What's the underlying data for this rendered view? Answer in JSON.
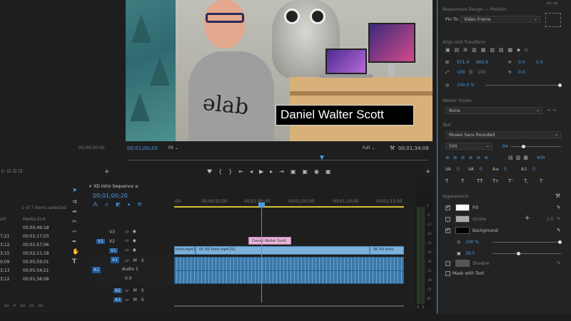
{
  "program_monitor": {
    "lower_third": "Daniel Walter Scott",
    "shirt_text": "ǝlab",
    "timecode_current": "00;01;00;20",
    "fit": "Fit",
    "quality": "Full",
    "timecode_duration": "00;01;34;09",
    "source_timecode": "00;00;00;00"
  },
  "project": {
    "items_selected": "1 of 7 items selected",
    "col_start": "art",
    "col_end": "Media End",
    "rows": [
      {
        "start": "",
        "end": "00;00;49;18"
      },
      {
        "start": "7;21",
        "end": "00;01;17;03"
      },
      {
        "start": "3;12",
        "end": "00;01;57;06"
      },
      {
        "start": "3;15",
        "end": "00;02;11;18"
      },
      {
        "start": "0;09",
        "end": "00;05;59;01"
      },
      {
        "start": "3;13",
        "end": "00;05;54;21"
      },
      {
        "start": "3;12",
        "end": "00;01;34;08"
      }
    ]
  },
  "timeline": {
    "sequence_name": "XD Intro Sequence",
    "timecode": "00;01;00;20",
    "ruler": [
      ";00",
      "00;00;55;00",
      "00;01;00;00",
      "00;01;05;00",
      "00;01;10;00",
      "00;01;15;00"
    ],
    "video_tracks": [
      "V3",
      "V2",
      "V1"
    ],
    "audio_tracks": [
      "A1",
      "A2",
      "A3"
    ],
    "audio_label": "Audio 1",
    "graphic_clip": "Daniel Walter Scott",
    "clip_left": "Intro.mp4 [V]",
    "clip_mid": "05 XD Intro.mp4 [V]",
    "clip_right": "06 XD Intro",
    "audio_volume": "0.0",
    "meter_scale": [
      "0",
      "-6",
      "-12",
      "-18",
      "-24",
      "-30",
      "-36",
      "-42",
      "-48",
      "-54",
      "dB"
    ],
    "meter_labels": [
      "S",
      "S"
    ]
  },
  "essential_graphics": {
    "responsive_heading": "Responsive Design — Position",
    "pin_to_label": "Pin To:",
    "pin_to_value": "Video Frame",
    "align_heading": "Align and Transform",
    "pos_x": "971.4",
    "pos_y": "960.6",
    "anchor_x": "0.0",
    "anchor_y": "0.0",
    "scale_w": "100",
    "scale_h": "100",
    "rotation": "0.0",
    "opacity": "100.0 %",
    "master_heading": "Master Styles",
    "master_value": "None",
    "text_heading": "Text",
    "font": "Museo Sans Rounded",
    "weight": "500",
    "size": "94",
    "tracking_vals": [
      "0",
      "0",
      "0",
      "0"
    ],
    "leading_val": "400",
    "style_buttons": [
      "T",
      "T",
      "TT",
      "Tт",
      "T'",
      "T,",
      "T"
    ],
    "appearance_heading": "Appearance",
    "fill_label": "Fill",
    "stroke_label": "Stroke",
    "stroke_width": "1.0",
    "background_label": "Background",
    "bg_opacity": "100 %",
    "bg_size": "39.5",
    "shadow_label": "Shadow",
    "mask_label": "Mask with Text",
    "colors": {
      "accent": "#4a9be8",
      "fill": "#ffffff",
      "background": "#000000",
      "graphic_clip": "#e8b4d8",
      "video_clip": "#7bb0d8",
      "audio_clip": "#3b78a8"
    }
  }
}
